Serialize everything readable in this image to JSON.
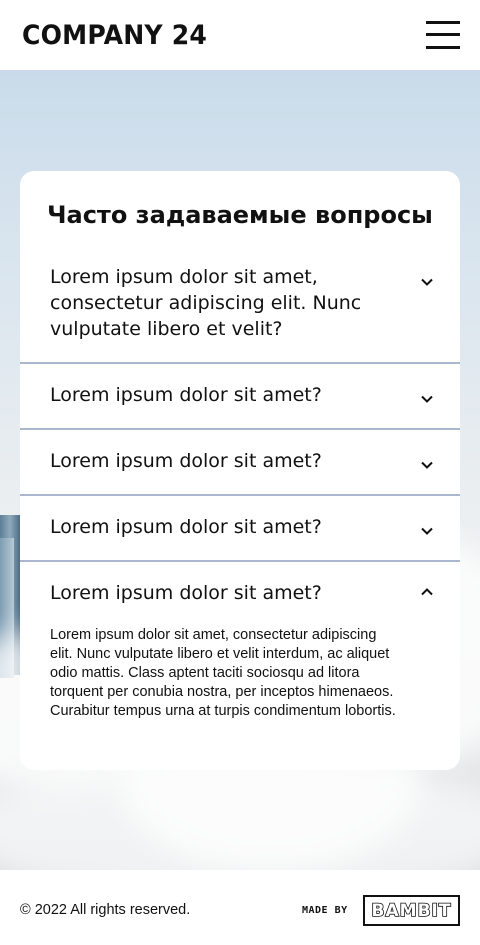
{
  "header": {
    "logo_text": "COMPANY 24",
    "menu_icon": "hamburger-menu-icon"
  },
  "faq": {
    "title": "Часто задаваемые вопросы",
    "items": [
      {
        "question": "Lorem ipsum dolor sit amet, consectetur adipiscing elit. Nunc vulputate libero et velit?",
        "expanded": false,
        "icon": "chevron-down-icon"
      },
      {
        "question": "Lorem ipsum dolor sit amet?",
        "expanded": false,
        "icon": "chevron-down-icon"
      },
      {
        "question": "Lorem ipsum dolor sit amet?",
        "expanded": false,
        "icon": "chevron-down-icon"
      },
      {
        "question": "Lorem ipsum dolor sit amet?",
        "expanded": false,
        "icon": "chevron-down-icon"
      },
      {
        "question": "Lorem ipsum dolor sit amet?",
        "expanded": true,
        "icon": "chevron-up-icon",
        "answer": "Lorem ipsum dolor sit amet, consectetur adipiscing elit. Nunc vulputate libero et velit interdum, ac aliquet odio mattis. Class aptent taciti sociosqu ad litora torquent per conubia nostra, per inceptos himenaeos. Curabitur tempus urna at turpis condimentum lobortis."
      }
    ]
  },
  "footer": {
    "copyright": "© 2022 All rights reserved.",
    "made_by_label": "MADE BY",
    "made_by_brand": "BAMBIT"
  },
  "colors": {
    "divider": "#a9b6cb",
    "text": "#111111",
    "card_bg": "#ffffff"
  }
}
